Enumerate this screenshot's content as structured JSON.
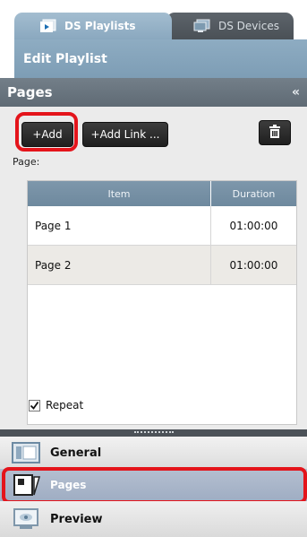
{
  "tabs": {
    "playlists_label": "DS Playlists",
    "devices_label": "DS Devices",
    "active": "DS Playlists"
  },
  "header": {
    "edit_title": "Edit Playlist"
  },
  "pages_section": {
    "title": "Pages",
    "collapse_glyph": "«"
  },
  "toolbar": {
    "add_label": "+Add",
    "add_link_label": "+Add Link ...",
    "delete_icon": "trash-icon"
  },
  "page_label": "Page:",
  "table": {
    "columns": [
      "Item",
      "Duration"
    ],
    "rows": [
      {
        "item": "Page 1",
        "duration": "01:00:00"
      },
      {
        "item": "Page 2",
        "duration": "01:00:00"
      }
    ]
  },
  "repeat": {
    "label": "Repeat",
    "checked": true
  },
  "nav": {
    "general_label": "General",
    "pages_label": "Pages",
    "preview_label": "Preview",
    "selected": "Pages"
  },
  "colors": {
    "highlight": "#e4141b",
    "tab_active": "#8aa8bf",
    "header_bar": "#6b7680",
    "table_header": "#7e97ab"
  }
}
